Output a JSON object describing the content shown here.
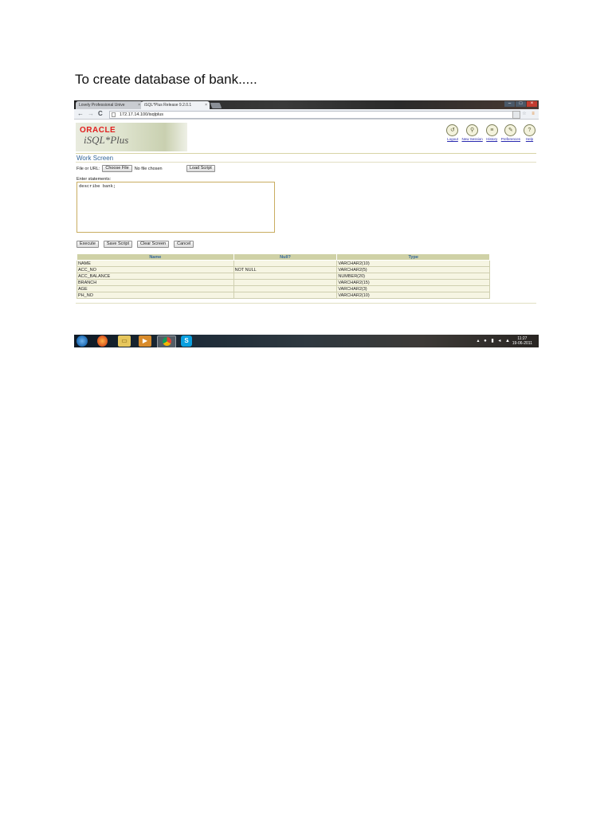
{
  "document": {
    "heading": "To  create database of bank....."
  },
  "browser": {
    "tabs": [
      {
        "label": "Lovely Professional Unive"
      },
      {
        "label": "iSQL*Plus Release 9.2.0.1"
      }
    ],
    "tab_close": "×",
    "address": "172.17.14.100/isqlplus",
    "nav": {
      "back": "←",
      "forward": "→",
      "reload": "C"
    }
  },
  "app": {
    "brand": "ORACLE",
    "product": "iSQL*Plus",
    "top_links": [
      {
        "label": "Logout",
        "glyph": "↺"
      },
      {
        "label": "New Session",
        "glyph": "⚲"
      },
      {
        "label": "History",
        "glyph": "≡"
      },
      {
        "label": "Preferences",
        "glyph": "✎"
      },
      {
        "label": "Help",
        "glyph": "?"
      }
    ],
    "screen_title": "Work Screen",
    "file_label": "File or URL:",
    "choose_file": "Choose File",
    "no_file": "No file chosen",
    "load_script": "Load Script",
    "enter_label": "Enter statements:",
    "statement": "describe bank;",
    "buttons": {
      "execute": "Execute",
      "save": "Save Script",
      "clear": "Clear Screen",
      "cancel": "Cancel"
    },
    "result": {
      "headers": [
        "Name",
        "Null?",
        "Type"
      ],
      "rows": [
        [
          "NAME",
          "",
          "VARCHAR2(10)"
        ],
        [
          "ACC_NO",
          "NOT NULL",
          "VARCHAR2(5)"
        ],
        [
          "ACC_BALANCE",
          "",
          "NUMBER(20)"
        ],
        [
          "BRANCH",
          "",
          "VARCHAR2(15)"
        ],
        [
          "AGE",
          "",
          "VARCHAR2(3)"
        ],
        [
          "PH_NO",
          "",
          "VARCHAR2(10)"
        ]
      ]
    }
  },
  "taskbar": {
    "clock_time": "11:27",
    "clock_date": "19-06-2011"
  }
}
